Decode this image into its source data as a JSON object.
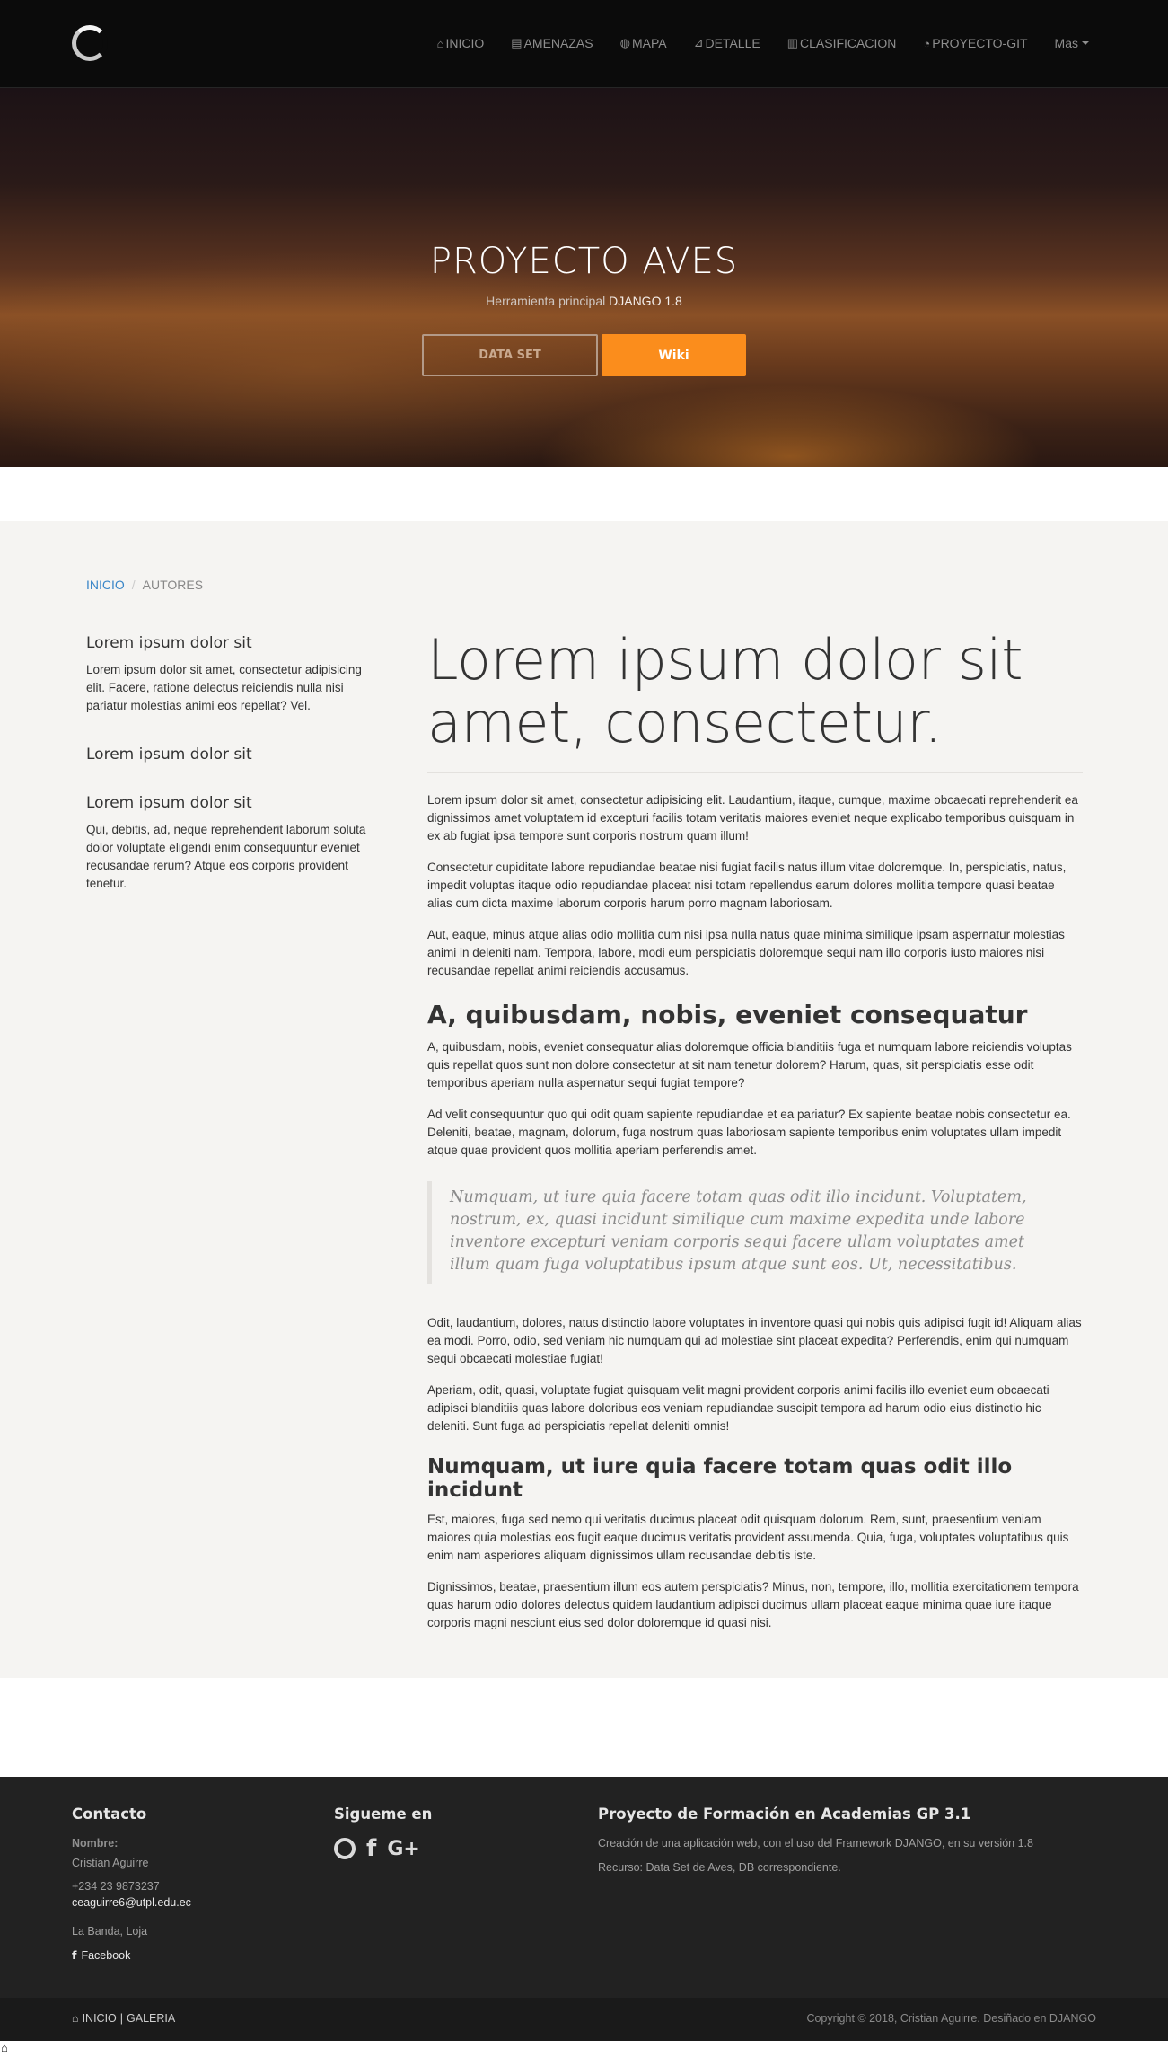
{
  "nav": {
    "items": [
      {
        "icon": "home-icon",
        "glyph": "⌂",
        "label": "INICIO"
      },
      {
        "icon": "list-icon",
        "glyph": "▤",
        "label": "AMENAZAS"
      },
      {
        "icon": "globe-icon",
        "glyph": "◍",
        "label": "MAPA"
      },
      {
        "icon": "line-chart-icon",
        "glyph": "⊿",
        "label": "DETALLE"
      },
      {
        "icon": "area-chart-icon",
        "glyph": "▥",
        "label": "CLASIFICACION"
      },
      {
        "icon": "github-icon",
        "glyph": "◔",
        "label": "PROYECTO-GIT"
      }
    ],
    "more_label": "Mas"
  },
  "hero": {
    "title": "PROYECTO AVES",
    "subtitle_prefix": "Herramienta principal",
    "subtitle_highlight": "DJANGO 1.8",
    "btn_dataset": "DATA SET",
    "btn_wiki": "Wiki",
    "accent": "#fb8d1c"
  },
  "breadcrumb": {
    "home": "INICIO",
    "separator": "/",
    "current": "AUTORES"
  },
  "sidebar": [
    {
      "heading": "Lorem ipsum dolor sit",
      "text": "Lorem ipsum dolor sit amet, consectetur adipisicing elit. Facere, ratione delectus reiciendis nulla nisi pariatur molestias animi eos repellat? Vel."
    },
    {
      "heading": "Lorem ipsum dolor sit",
      "text": ""
    },
    {
      "heading": "Lorem ipsum dolor sit",
      "text": "Qui, debitis, ad, neque reprehenderit laborum soluta dolor voluptate eligendi enim consequuntur eveniet recusandae rerum? Atque eos corporis provident tenetur."
    }
  ],
  "main": {
    "title": "Lorem ipsum dolor sit amet, consectetur.",
    "p1": "Lorem ipsum dolor sit amet, consectetur adipisicing elit. Laudantium, itaque, cumque, maxime obcaecati reprehenderit ea dignissimos amet voluptatem id excepturi facilis totam veritatis maiores eveniet neque explicabo temporibus quisquam in ex ab fugiat ipsa tempore sunt corporis nostrum quam illum!",
    "p2": "Consectetur cupiditate labore repudiandae beatae nisi fugiat facilis natus illum vitae doloremque. In, perspiciatis, natus, impedit voluptas itaque odio repudiandae placeat nisi totam repellendus earum dolores mollitia tempore quasi beatae alias cum dicta maxime laborum corporis harum porro magnam laboriosam.",
    "p3": "Aut, eaque, minus atque alias odio mollitia cum nisi ipsa nulla natus quae minima similique ipsam aspernatur molestias animi in deleniti nam. Tempora, labore, modi eum perspiciatis doloremque sequi nam illo corporis iusto maiores nisi recusandae repellat animi reiciendis accusamus.",
    "h2": "A, quibusdam, nobis, eveniet consequatur",
    "p4": "A, quibusdam, nobis, eveniet consequatur alias doloremque officia blanditiis fuga et numquam labore reiciendis voluptas quis repellat quos sunt non dolore consectetur at sit nam tenetur dolorem? Harum, quas, sit perspiciatis esse odit temporibus aperiam nulla aspernatur sequi fugiat tempore?",
    "p5": "Ad velit consequuntur quo qui odit quam sapiente repudiandae et ea pariatur? Ex sapiente beatae nobis consectetur ea. Deleniti, beatae, magnam, dolorum, fuga nostrum quas laboriosam sapiente temporibus enim voluptates ullam impedit atque quae provident quos mollitia aperiam perferendis amet.",
    "quote": "Numquam, ut iure quia facere totam quas odit illo incidunt. Voluptatem, nostrum, ex, quasi incidunt similique cum maxime expedita unde labore inventore excepturi veniam corporis sequi facere ullam voluptates amet illum quam fuga voluptatibus ipsum atque sunt eos. Ut, necessitatibus.",
    "p6": "Odit, laudantium, dolores, natus distinctio labore voluptates in inventore quasi qui nobis quis adipisci fugit id! Aliquam alias ea modi. Porro, odio, sed veniam hic numquam qui ad molestiae sint placeat expedita? Perferendis, enim qui numquam sequi obcaecati molestiae fugiat!",
    "p7": "Aperiam, odit, quasi, voluptate fugiat quisquam velit magni provident corporis animi facilis illo eveniet eum obcaecati adipisci blanditiis quas labore doloribus eos veniam repudiandae suscipit tempora ad harum odio eius distinctio hic deleniti. Sunt fuga ad perspiciatis repellat deleniti omnis!",
    "h3": "Numquam, ut iure quia facere totam quas odit illo incidunt",
    "p8": "Est, maiores, fuga sed nemo qui veritatis ducimus placeat odit quisquam dolorum. Rem, sunt, praesentium veniam maiores quia molestias eos fugit eaque ducimus veritatis provident assumenda. Quia, fuga, voluptates voluptatibus quis enim nam asperiores aliquam dignissimos ullam recusandae debitis iste.",
    "p9": "Dignissimos, beatae, praesentium illum eos autem perspiciatis? Minus, non, tempore, illo, mollitia exercitationem tempora quas harum odio dolores delectus quidem laudantium adipisci ducimus ullam placeat eaque minima quae iure itaque corporis magni nesciunt eius sed dolor doloremque id quasi nisi."
  },
  "footer": {
    "contact": {
      "heading": "Contacto",
      "name_label": "Nombre:",
      "name": "Cristian Aguirre",
      "phone": "+234 23 9873237",
      "email": "ceaguirre6@utpl.edu.ec",
      "location": "La Banda, Loja",
      "facebook": "Facebook"
    },
    "social": {
      "heading": "Sigueme en",
      "icons": [
        "github-icon",
        "facebook-icon",
        "google-plus-icon"
      ]
    },
    "project": {
      "heading": "Proyecto de Formación en Academias GP 3.1",
      "line1": "Creación de una aplicación web, con el uso del Framework DJANGO, en su versión 1.8",
      "line2": "Recurso: Data Set de Aves, DB correspondiente."
    }
  },
  "bottom_bar": {
    "home": "INICIO",
    "separator": "|",
    "gallery": "GALERIA",
    "copyright": "Copyright © 2018, Cristian Aguirre. Desiñado en DJANGO"
  }
}
